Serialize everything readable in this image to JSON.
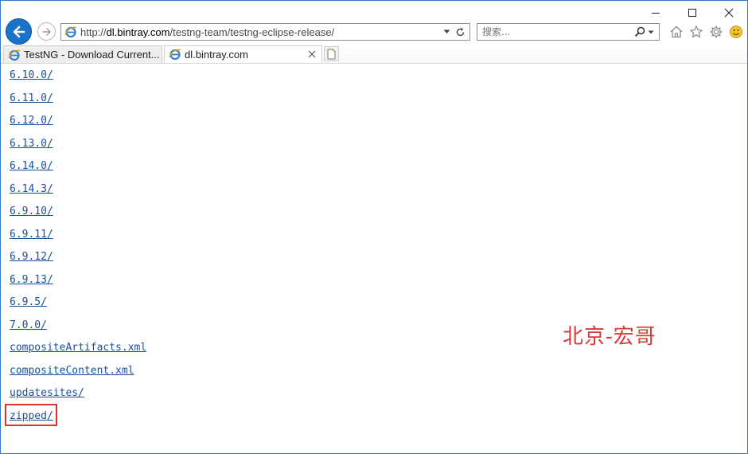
{
  "window": {
    "controls": {
      "minimize": "minimize",
      "maximize": "maximize",
      "close": "close"
    }
  },
  "navigation": {
    "back_icon": "back-arrow-icon",
    "forward_icon": "forward-arrow-icon",
    "address": {
      "scheme": "http://",
      "domain": "dl.bintray.com",
      "path": "/testng-team/testng-eclipse-release/"
    },
    "search": {
      "placeholder": "搜索..."
    },
    "toolbar_icons": [
      "home-icon",
      "favorites-star-icon",
      "settings-gear-icon",
      "smiley-feedback-icon"
    ]
  },
  "tabs": [
    {
      "label": "TestNG - Download Current...",
      "active": false
    },
    {
      "label": "dl.bintray.com",
      "active": true
    }
  ],
  "listing": {
    "links": [
      "6.10.0/",
      "6.11.0/",
      "6.12.0/",
      "6.13.0/",
      "6.14.0/",
      "6.14.3/",
      "6.9.10/",
      "6.9.11/",
      "6.9.12/",
      "6.9.13/",
      "6.9.5/",
      "7.0.0/",
      "compositeArtifacts.xml",
      "compositeContent.xml",
      "updatesites/",
      "zipped/"
    ],
    "highlighted": "zipped/"
  },
  "watermark": "北京-宏哥",
  "colors": {
    "link": "#1a4f9c",
    "highlight": "#d9342b",
    "watermark": "#d73b32",
    "accent": "#1a72c9"
  }
}
